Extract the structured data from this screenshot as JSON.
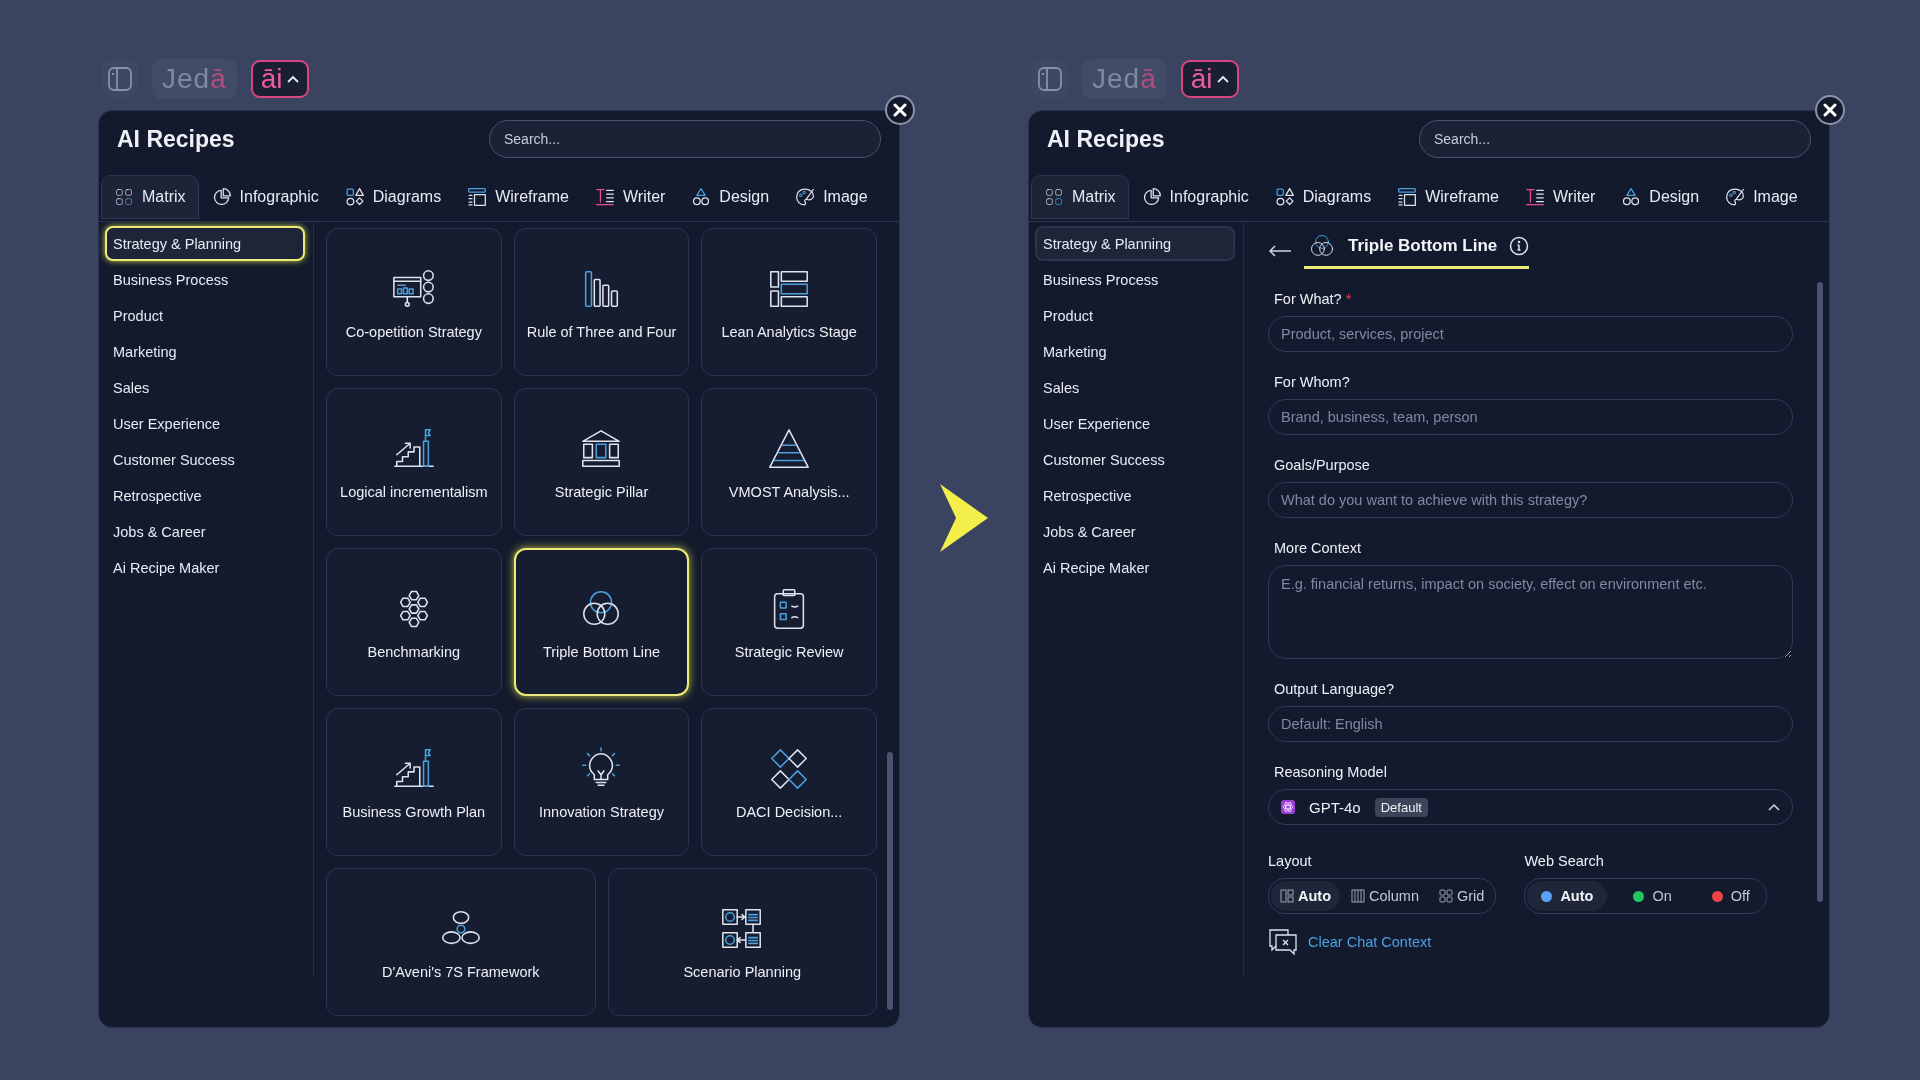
{
  "panels": [
    {
      "toolbar": {
        "logo": "Jedā",
        "ai_button": "āi"
      },
      "title": "AI Recipes",
      "search": {
        "placeholder": "Search..."
      },
      "tabs": [
        {
          "label": "Matrix",
          "selected": true
        },
        {
          "label": "Infographic",
          "selected": false
        },
        {
          "label": "Diagrams",
          "selected": false
        },
        {
          "label": "Wireframe",
          "selected": false
        },
        {
          "label": "Writer",
          "selected": false
        },
        {
          "label": "Design",
          "selected": false
        },
        {
          "label": "Image",
          "selected": false
        }
      ],
      "categories": [
        {
          "label": "Strategy & Planning",
          "selected": true,
          "focused": true
        },
        {
          "label": "Business Process",
          "selected": false,
          "focused": false
        },
        {
          "label": "Product",
          "selected": false,
          "focused": false
        },
        {
          "label": "Marketing",
          "selected": false,
          "focused": false
        },
        {
          "label": "Sales",
          "selected": false,
          "focused": false
        },
        {
          "label": "User Experience",
          "selected": false,
          "focused": false
        },
        {
          "label": "Customer Success",
          "selected": false,
          "focused": false
        },
        {
          "label": "Retrospective",
          "selected": false,
          "focused": false
        },
        {
          "label": "Jobs & Career",
          "selected": false,
          "focused": false
        },
        {
          "label": "Ai Recipe Maker",
          "selected": false,
          "focused": false
        }
      ],
      "view": {
        "kind": "recipe_grid",
        "recipes": [
          {
            "label": "Co-opetition Strategy",
            "selected": false
          },
          {
            "label": "Rule of Three and Four",
            "selected": false
          },
          {
            "label": "Lean Analytics Stage",
            "selected": false
          },
          {
            "label": "Logical incrementalism",
            "selected": false
          },
          {
            "label": "Strategic Pillar",
            "selected": false
          },
          {
            "label": "VMOST Analysis...",
            "selected": false
          },
          {
            "label": "Benchmarking",
            "selected": false
          },
          {
            "label": "Triple Bottom Line",
            "selected": true
          },
          {
            "label": "Strategic Review",
            "selected": false
          },
          {
            "label": "Business Growth Plan",
            "selected": false
          },
          {
            "label": "Innovation Strategy",
            "selected": false
          },
          {
            "label": "DACI Decision...",
            "selected": false
          },
          {
            "label": "D'Aveni's 7S Framework",
            "selected": false
          },
          {
            "label": "Scenario Planning",
            "selected": false
          }
        ]
      }
    },
    {
      "toolbar": {
        "logo": "Jedā",
        "ai_button": "āi"
      },
      "title": "AI Recipes",
      "search": {
        "placeholder": "Search..."
      },
      "tabs": [
        {
          "label": "Matrix",
          "selected": true
        },
        {
          "label": "Infographic",
          "selected": false
        },
        {
          "label": "Diagrams",
          "selected": false
        },
        {
          "label": "Wireframe",
          "selected": false
        },
        {
          "label": "Writer",
          "selected": false
        },
        {
          "label": "Design",
          "selected": false
        },
        {
          "label": "Image",
          "selected": false
        }
      ],
      "categories": [
        {
          "label": "Strategy & Planning",
          "selected": true,
          "focused": false
        },
        {
          "label": "Business Process",
          "selected": false,
          "focused": false
        },
        {
          "label": "Product",
          "selected": false,
          "focused": false
        },
        {
          "label": "Marketing",
          "selected": false,
          "focused": false
        },
        {
          "label": "Sales",
          "selected": false,
          "focused": false
        },
        {
          "label": "User Experience",
          "selected": false,
          "focused": false
        },
        {
          "label": "Customer Success",
          "selected": false,
          "focused": false
        },
        {
          "label": "Retrospective",
          "selected": false,
          "focused": false
        },
        {
          "label": "Jobs & Career",
          "selected": false,
          "focused": false
        },
        {
          "label": "Ai Recipe Maker",
          "selected": false,
          "focused": false
        }
      ],
      "view": {
        "kind": "recipe_form",
        "title": "Triple Bottom Line",
        "fields": [
          {
            "kind": "text",
            "label": "For What?",
            "required_mark": "*",
            "placeholder": "Product, services, project"
          },
          {
            "kind": "text",
            "label": "For Whom?",
            "placeholder": "Brand, business, team, person"
          },
          {
            "kind": "text",
            "label": "Goals/Purpose",
            "placeholder": "What do you want to achieve with this strategy?"
          },
          {
            "kind": "textarea",
            "label": "More Context",
            "placeholder": "E.g. financial returns, impact on society, effect on environment etc."
          },
          {
            "kind": "text",
            "label": "Output Language?",
            "placeholder": "Default: English"
          }
        ],
        "model": {
          "label": "Reasoning Model",
          "value": "GPT-4o",
          "badge": "Default",
          "expanded": true
        },
        "layout": {
          "label": "Layout",
          "options": [
            {
              "label": "Auto",
              "selected": true
            },
            {
              "label": "Column",
              "selected": false
            },
            {
              "label": "Grid",
              "selected": false
            }
          ]
        },
        "web_search": {
          "label": "Web Search",
          "options": [
            {
              "label": "Auto",
              "selected": true,
              "color": "#5aa2f5"
            },
            {
              "label": "On",
              "selected": false,
              "color": "#22c55e"
            },
            {
              "label": "Off",
              "selected": false,
              "color": "#ef4444"
            }
          ]
        },
        "clear_link": "Clear Chat Context"
      }
    }
  ]
}
